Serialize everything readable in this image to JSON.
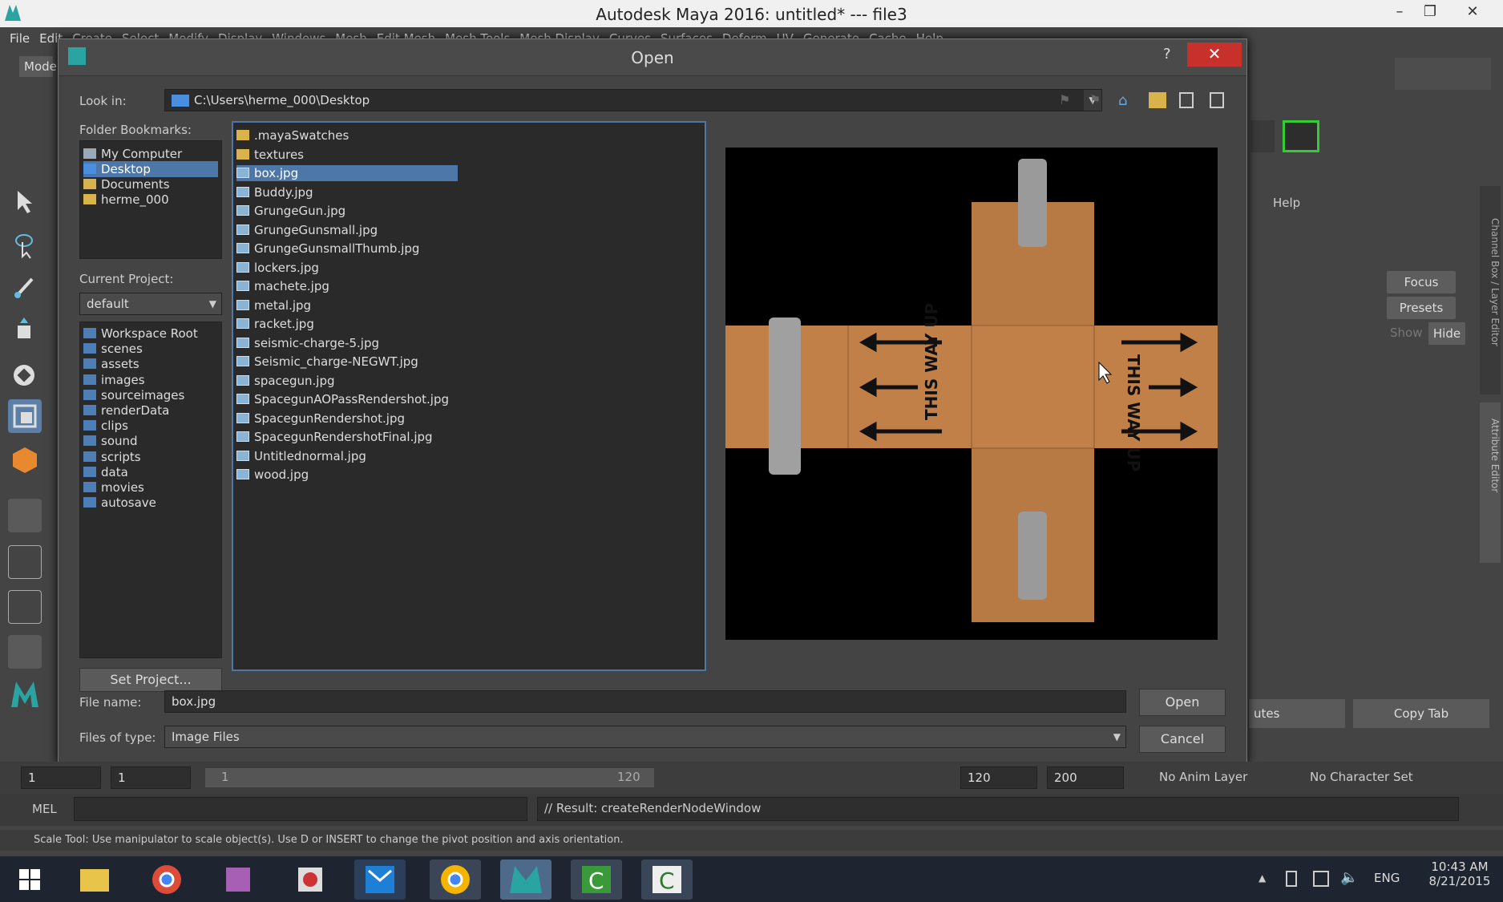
{
  "app": {
    "title": "Autodesk Maya 2016: untitled*   ---   file3"
  },
  "menu": [
    "File",
    "Edit",
    "Create",
    "Select",
    "Modify",
    "Display",
    "Windows",
    "Mesh",
    "Edit Mesh",
    "Mesh Tools",
    "Mesh Display",
    "Curves",
    "Surfaces",
    "Deform",
    "UV",
    "Generate",
    "Cache",
    "Help"
  ],
  "mode_label": "Mode",
  "right": {
    "help": "Help",
    "focus": "Focus",
    "presets": "Presets",
    "show": "Show",
    "hide": "Hide",
    "copy_tab": "Copy Tab",
    "attributes_partial": "utes",
    "channel_box_tab": "Channel Box / Layer Editor",
    "attribute_editor_tab": "Attribute Editor"
  },
  "dialog": {
    "title": "Open",
    "help": "?",
    "close": "✕",
    "look_in_label": "Look in:",
    "look_in_value": "C:\\Users\\herme_000\\Desktop",
    "bookmarks_label": "Folder Bookmarks:",
    "bookmarks": [
      "My Computer",
      "Desktop",
      "Documents",
      "herme_000"
    ],
    "current_project_label": "Current Project:",
    "current_project": "default",
    "project_folders": [
      "Workspace Root",
      "scenes",
      "assets",
      "images",
      "sourceimages",
      "renderData",
      "clips",
      "sound",
      "scripts",
      "data",
      "movies",
      "autosave"
    ],
    "set_project": "Set Project...",
    "files": [
      ".mayaSwatches",
      "textures",
      "box.jpg",
      "Buddy.jpg",
      "GrungeGun.jpg",
      "GrungeGunsmall.jpg",
      "GrungeGunsmallThumb.jpg",
      "lockers.jpg",
      "machete.jpg",
      "metal.jpg",
      "racket.jpg",
      "seismic-charge-5.jpg",
      "Seismic_charge-NEGWT.jpg",
      "spacegun.jpg",
      "SpacegunAOPassRendershot.jpg",
      "SpacegunRendershot.jpg",
      "SpacegunRendershotFinal.jpg",
      "Untitlednormal.jpg",
      "wood.jpg"
    ],
    "selected_file": "box.jpg",
    "file_name_label": "File name:",
    "file_name": "box.jpg",
    "files_of_type_label": "Files of type:",
    "files_of_type": "Image Files",
    "open": "Open",
    "cancel": "Cancel",
    "preview_text": "THIS WAY UP"
  },
  "timeline": {
    "start": "1",
    "range_start": "1",
    "range_mark": "1",
    "range_end_inner": "120",
    "range_end": "120",
    "anim_end": "200",
    "anim_layer": "No Anim Layer",
    "char_set": "No Character Set"
  },
  "mel": {
    "label": "MEL",
    "result": "// Result: createRenderNodeWindow"
  },
  "status": "Scale Tool: Use manipulator to scale object(s). Use D or INSERT to change the pivot position and axis orientation.",
  "taskbar": {
    "lang": "ENG",
    "time": "10:43 AM",
    "date": "8/21/2015"
  }
}
